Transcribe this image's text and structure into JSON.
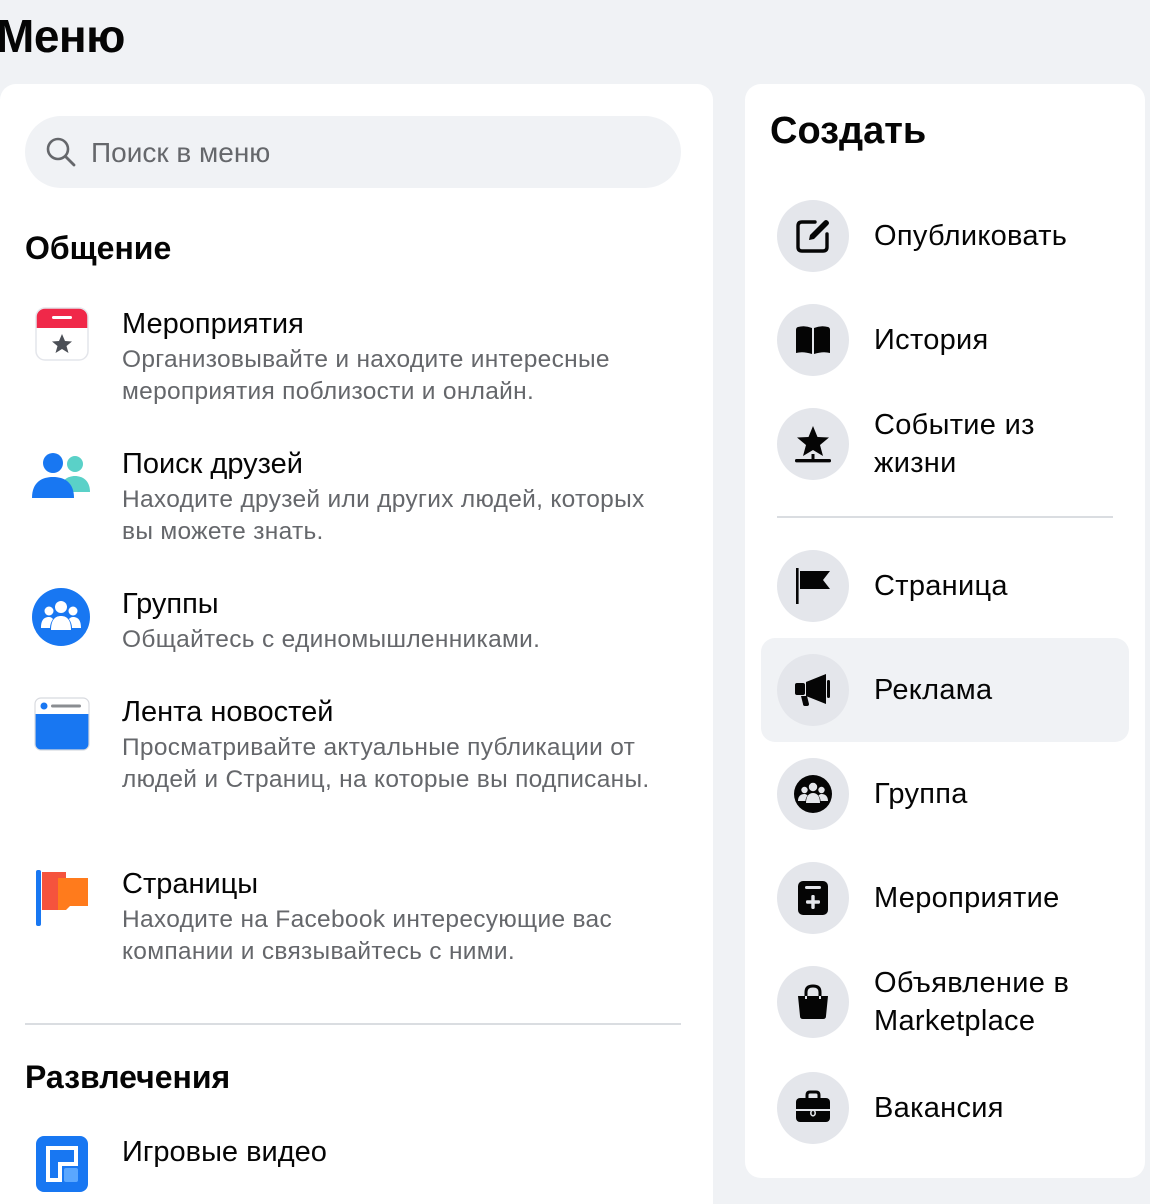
{
  "page": {
    "title": "Меню"
  },
  "search": {
    "placeholder": "Поиск в меню"
  },
  "menu": {
    "sections": [
      {
        "title": "Общение",
        "items": [
          {
            "title": "Мероприятия",
            "description": "Организовывайте и находите интересные мероприятия поблизости и онлайн.",
            "icon": "events-icon"
          },
          {
            "title": "Поиск друзей",
            "description": "Находите друзей или других людей, которых вы можете знать.",
            "icon": "friends-icon"
          },
          {
            "title": "Группы",
            "description": "Общайтесь с единомышленниками.",
            "icon": "groups-icon"
          },
          {
            "title": "Лента новостей",
            "description": "Просматривайте актуальные публикации от людей и Страниц, на которые вы подписаны.",
            "icon": "news-feed-icon"
          },
          {
            "title": "Страницы",
            "description": "Находите на Facebook интересующие вас компании и связывайтесь с ними.",
            "icon": "pages-flag-icon"
          }
        ]
      },
      {
        "title": "Развлечения",
        "items": [
          {
            "title": "Игровые видео",
            "description": "",
            "icon": "gaming-video-icon"
          }
        ]
      }
    ]
  },
  "create": {
    "title": "Создать",
    "items": [
      {
        "label": "Опубликовать",
        "icon": "edit-post-icon"
      },
      {
        "label": "История",
        "icon": "story-book-icon"
      },
      {
        "label": "Событие из жизни",
        "icon": "life-event-star-icon"
      },
      {
        "label": "Страница",
        "icon": "page-flag-icon"
      },
      {
        "label": "Реклама",
        "icon": "megaphone-icon"
      },
      {
        "label": "Группа",
        "icon": "group-icon"
      },
      {
        "label": "Мероприятие",
        "icon": "event-calendar-plus-icon"
      },
      {
        "label": "Объявление в Marketplace",
        "icon": "shopping-bag-icon"
      },
      {
        "label": "Вакансия",
        "icon": "briefcase-icon"
      }
    ]
  },
  "colors": {
    "background": "#f0f2f5",
    "panel": "#ffffff",
    "secondary_text": "#65676b",
    "icon_circle": "#e4e6eb",
    "accent_blue": "#1877f2"
  }
}
